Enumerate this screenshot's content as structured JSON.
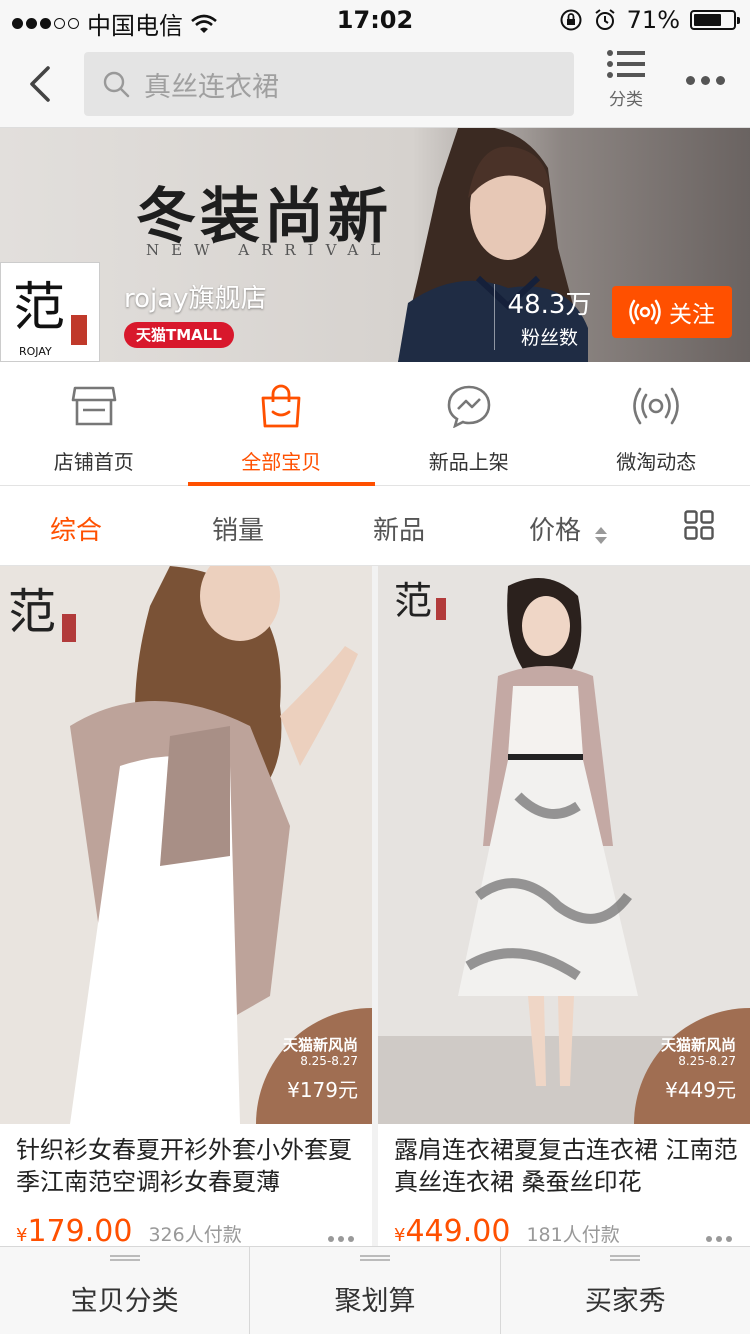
{
  "status_bar": {
    "carrier": "中国电信",
    "time": "17:02",
    "battery": "71%",
    "battery_level": 0.71
  },
  "nav": {
    "search_placeholder": "真丝连衣裙",
    "category_label": "分类"
  },
  "banner": {
    "headline": "冬装尚新",
    "subline": "NEW ARRIVAL",
    "store_name": "rojay旗舰店",
    "tmall_badge": "天猫TMALL",
    "fans_count": "48.3万",
    "fans_label": "粉丝数",
    "follow_label": "关注",
    "logo_text": "ROJAY"
  },
  "shop_tabs": [
    {
      "label": "店铺首页",
      "icon": "store-icon",
      "active": false
    },
    {
      "label": "全部宝贝",
      "icon": "bag-icon",
      "active": true
    },
    {
      "label": "新品上架",
      "icon": "new-arrival-icon",
      "active": false
    },
    {
      "label": "微淘动态",
      "icon": "feed-icon",
      "active": false
    }
  ],
  "sort_bar": {
    "items": [
      "综合",
      "销量",
      "新品",
      "价格"
    ],
    "active": "综合",
    "view_icon": "grid-view-icon"
  },
  "products": [
    {
      "title": "针织衫女春夏开衫外套小外套夏季江南范空调衫女春夏薄",
      "currency": "¥",
      "price": "179.00",
      "sales": "326人付款",
      "badge_title": "天猫新风尚",
      "badge_date": "8.25-8.27",
      "badge_price": "¥179元"
    },
    {
      "title": "露肩连衣裙夏复古连衣裙 江南范 真丝连衣裙 桑蚕丝印花",
      "currency": "¥",
      "price": "449.00",
      "sales": "181人付款",
      "badge_title": "天猫新风尚",
      "badge_date": "8.25-8.27",
      "badge_price": "¥449元"
    }
  ],
  "bottom_bar": [
    "宝贝分类",
    "聚划算",
    "买家秀"
  ],
  "colors": {
    "accent": "#ff5000",
    "tmall_red": "#d8182c"
  }
}
